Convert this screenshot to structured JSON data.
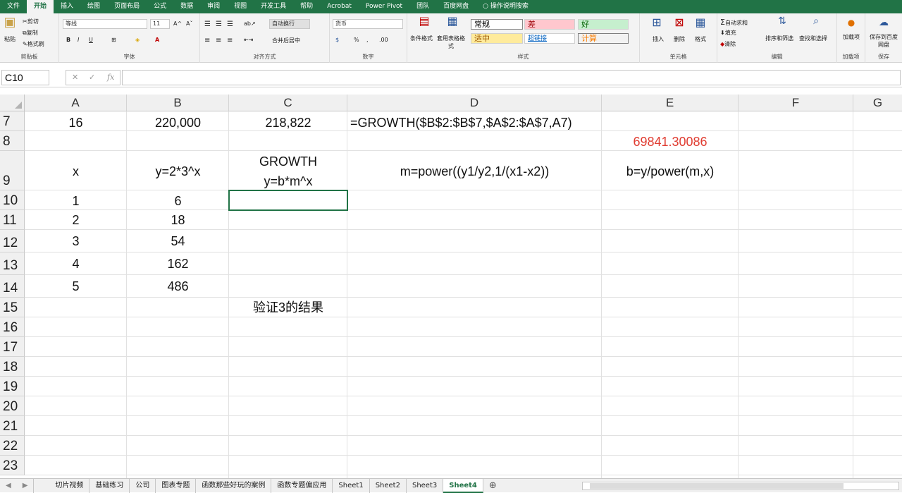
{
  "menu": [
    "文件",
    "开始",
    "插入",
    "绘图",
    "页面布局",
    "公式",
    "数据",
    "审阅",
    "视图",
    "开发工具",
    "帮助",
    "Acrobat",
    "Power Pivot",
    "团队",
    "百度网盘"
  ],
  "menu_active": "开始",
  "tell_me": "操作说明搜索",
  "ribbon": {
    "clipboard": {
      "label": "剪贴板",
      "paste": "粘贴",
      "cut": "剪切",
      "copy": "复制",
      "format_painter": "格式刷"
    },
    "font": {
      "label": "字体",
      "name": "等线",
      "size": "11",
      "bold": "B",
      "italic": "I",
      "underline": "U",
      "grow": "A^",
      "shrink": "Aˇ"
    },
    "alignment": {
      "label": "对齐方式",
      "wrap": "自动换行",
      "merge": "合并后居中"
    },
    "number": {
      "label": "数字",
      "format": "货币",
      "percent": "%",
      "comma": ","
    },
    "styles": {
      "label": "样式",
      "conditional": "条件格式",
      "table": "套用表格格式",
      "normal": "常规",
      "bad": "差",
      "good": "好",
      "neutral": "适中",
      "hyperlink": "超链接",
      "calc": "计算"
    },
    "cells": {
      "label": "单元格",
      "insert": "插入",
      "delete": "删除",
      "format": "格式"
    },
    "editing": {
      "label": "编辑",
      "autosum": "自动求和",
      "fill": "填充",
      "clear": "清除",
      "sort": "排序和筛选",
      "find": "查找和选择"
    },
    "addins": {
      "label": "加载项",
      "btn": "加载项"
    },
    "save": {
      "label": "保存",
      "btn": "保存到百度网盘"
    }
  },
  "formula_bar": {
    "name_box": "C10",
    "formula": ""
  },
  "columns": [
    "A",
    "B",
    "C",
    "D",
    "E",
    "F",
    "G"
  ],
  "rows": [
    {
      "num": "7",
      "cells": {
        "A": "16",
        "B": "220,000",
        "C": "218,822",
        "D": "=GROWTH($B$2:$B$7,$A$2:$A$7,A7)"
      }
    },
    {
      "num": "8",
      "cells": {
        "E": "69841.30086"
      }
    },
    {
      "num": "9",
      "cells": {
        "A": "x",
        "B": "y=2*3^x",
        "C1": "GROWTH",
        "C2": "y=b*m^x",
        "D": "m=power((y1/y2,1/(x1-x2))",
        "E": "b=y/power(m,x)"
      }
    },
    {
      "num": "10",
      "cells": {
        "A": "1",
        "B": "6"
      }
    },
    {
      "num": "11",
      "cells": {
        "A": "2",
        "B": "18"
      }
    },
    {
      "num": "12",
      "cells": {
        "A": "3",
        "B": "54"
      }
    },
    {
      "num": "13",
      "cells": {
        "A": "4",
        "B": "162"
      }
    },
    {
      "num": "14",
      "cells": {
        "A": "5",
        "B": "486"
      }
    },
    {
      "num": "15",
      "cells": {
        "C": "验证3的结果"
      }
    },
    {
      "num": "16",
      "cells": {}
    },
    {
      "num": "17",
      "cells": {}
    },
    {
      "num": "18",
      "cells": {}
    },
    {
      "num": "19",
      "cells": {}
    },
    {
      "num": "20",
      "cells": {}
    },
    {
      "num": "21",
      "cells": {}
    },
    {
      "num": "22",
      "cells": {}
    },
    {
      "num": "23",
      "cells": {}
    }
  ],
  "colors": {
    "accent": "#217346",
    "red_text": "#e03c31"
  },
  "sheets": [
    "切片视频",
    "基础练习",
    "公司",
    "图表专题",
    "函数那些好玩的案例",
    "函数专题偏应用",
    "Sheet1",
    "Sheet2",
    "Sheet3",
    "Sheet4"
  ],
  "active_sheet": "Sheet4"
}
